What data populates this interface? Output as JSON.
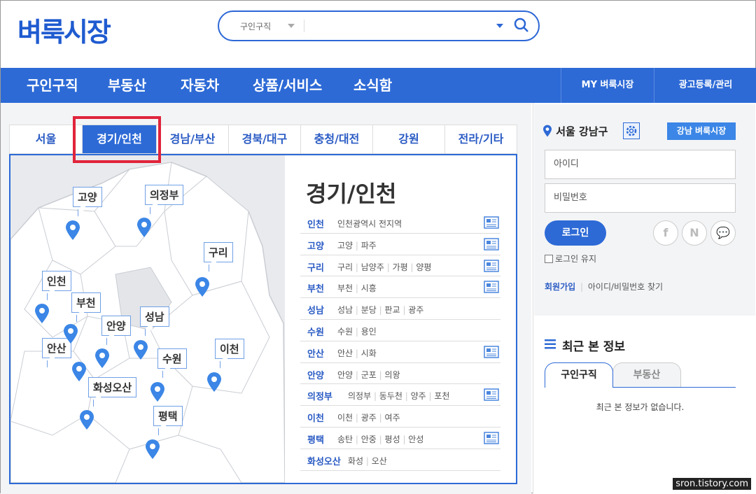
{
  "header": {
    "logo": "벼룩시장",
    "search": {
      "category": "구인구직",
      "value": "",
      "placeholder": ""
    }
  },
  "nav": {
    "items": [
      "구인구직",
      "부동산",
      "자동차",
      "상품/서비스",
      "소식함"
    ],
    "right": [
      "MY 벼룩시장",
      "광고등록/관리"
    ]
  },
  "region_tabs": [
    "서울",
    "경기/인천",
    "경남/부산",
    "경북/대구",
    "충청/대전",
    "강원",
    "전라/기타"
  ],
  "active_tab": "경기/인천",
  "map": {
    "labels": [
      "고양",
      "의정부",
      "구리",
      "인천",
      "부천",
      "안양",
      "성남",
      "안산",
      "수원",
      "이천",
      "화성오산",
      "평택"
    ]
  },
  "region": {
    "title": "경기/인천",
    "rows": [
      {
        "city": "인천",
        "subs": [
          "인천광역시 전지역"
        ],
        "newspaper": true
      },
      {
        "city": "고양",
        "subs": [
          "고양",
          "파주"
        ],
        "newspaper": true
      },
      {
        "city": "구리",
        "subs": [
          "구리",
          "남양주",
          "가평",
          "양평"
        ],
        "newspaper": true
      },
      {
        "city": "부천",
        "subs": [
          "부천",
          "시흥"
        ],
        "newspaper": true
      },
      {
        "city": "성남",
        "subs": [
          "성남",
          "분당",
          "판교",
          "광주"
        ],
        "newspaper": false
      },
      {
        "city": "수원",
        "subs": [
          "수원",
          "용인"
        ],
        "newspaper": false
      },
      {
        "city": "안산",
        "subs": [
          "안산",
          "시화"
        ],
        "newspaper": true
      },
      {
        "city": "안양",
        "subs": [
          "안양",
          "군포",
          "의왕"
        ],
        "newspaper": false
      },
      {
        "city": "의정부",
        "subs": [
          "의정부",
          "동두천",
          "양주",
          "포천"
        ],
        "newspaper": true
      },
      {
        "city": "이천",
        "subs": [
          "이천",
          "광주",
          "여주"
        ],
        "newspaper": false
      },
      {
        "city": "평택",
        "subs": [
          "송탄",
          "안중",
          "평성",
          "안성"
        ],
        "newspaper": true
      },
      {
        "city": "화성오산",
        "subs": [
          "화성",
          "오산"
        ],
        "newspaper": false
      }
    ]
  },
  "login": {
    "location": "서울 강남구",
    "badge": "강남 벼룩시장",
    "id_placeholder": "아이디",
    "pw_placeholder": "비밀번호",
    "login_button": "로그인",
    "keep_login": "로그인 유지",
    "join": "회원가입",
    "find": "아이디/비밀번호 찾기",
    "social": [
      "f",
      "N",
      "💬"
    ]
  },
  "recent": {
    "title": "최근 본 정보",
    "tabs": [
      "구인구직",
      "부동산"
    ],
    "empty": "최근 본 정보가 없습니다."
  },
  "watermark": "sron.tistory.com",
  "colors": {
    "primary": "#2d6ad6",
    "highlight": "#e0243b",
    "pin": "#3b86e6"
  }
}
